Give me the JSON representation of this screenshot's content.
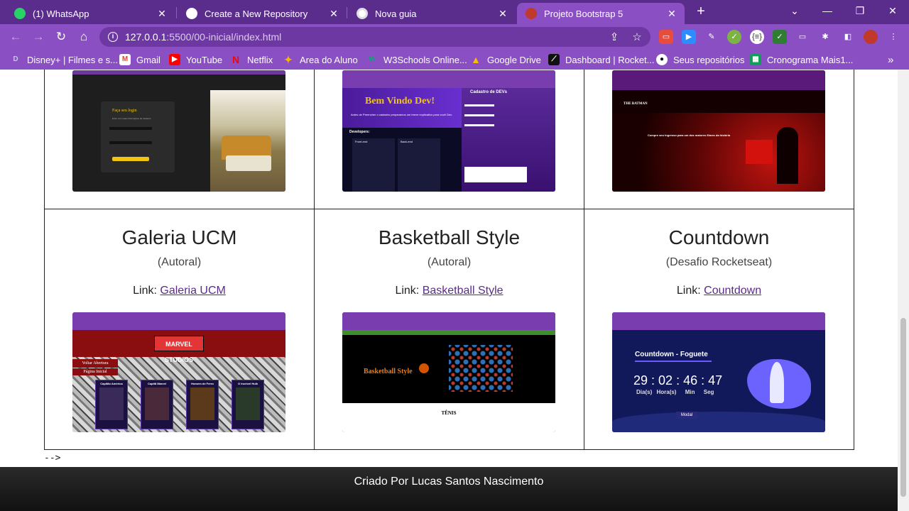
{
  "browser": {
    "tabs": [
      {
        "title": "(1) WhatsApp",
        "icon": "whatsapp-icon",
        "color": "#25d366"
      },
      {
        "title": "Create a New Repository",
        "icon": "github-icon",
        "color": "#ffffff"
      },
      {
        "title": "Nova guia",
        "icon": "chrome-icon",
        "color": "#ffffff"
      },
      {
        "title": "Projeto Bootstrap 5",
        "icon": "avatar-icon",
        "color": "#c0392b"
      }
    ],
    "address": {
      "host": "127.0.0.1",
      "path": ":5500/00-inicial/index.html"
    },
    "bookmarks": [
      {
        "label": "Disney+ | Filmes e s...",
        "icon": "disney-icon"
      },
      {
        "label": "Gmail",
        "icon": "gmail-icon"
      },
      {
        "label": "YouTube",
        "icon": "youtube-icon"
      },
      {
        "label": "Netflix",
        "icon": "netflix-icon"
      },
      {
        "label": "Area do Aluno",
        "icon": "star-icon"
      },
      {
        "label": "W3Schools Online...",
        "icon": "w3schools-icon"
      },
      {
        "label": "Google Drive",
        "icon": "drive-icon"
      },
      {
        "label": "Dashboard | Rocket...",
        "icon": "rocketseat-icon"
      },
      {
        "label": "Seus repositórios",
        "icon": "github-icon"
      },
      {
        "label": "Cronograma Mais1...",
        "icon": "sheets-icon"
      }
    ]
  },
  "top_row_previews": [
    {
      "login_title": "Faça seu login",
      "login_sub": "Entre com suas informações de cadastro"
    },
    {
      "welcome": "Bem Vindo Dev!",
      "welcome_text": "Antes de Preencher o cadastro preparamos um breve explicativo para você Dev.",
      "form_title": "Cadastro de DEVs",
      "developers": "Developers:",
      "front": "Front-end",
      "back": "Back-end"
    },
    {
      "brand": "THE BATMAN",
      "headline": "Compre seu Ingresso para um dos maiores filmes da história"
    }
  ],
  "projects": [
    {
      "title": "Galeria UCM",
      "subtitle": "(Autoral)",
      "link_prefix": "Link:",
      "link_label": "Galeria UCM"
    },
    {
      "title": "Basketball Style",
      "subtitle": "(Autoral)",
      "link_prefix": "Link:",
      "link_label": "Basketball Style"
    },
    {
      "title": "Countdown",
      "subtitle": "(Desafio Rocketseat)",
      "link_prefix": "Link:",
      "link_label": "Countdown"
    }
  ],
  "previews": {
    "ucm": {
      "banner": "MARVEL STUDIOS",
      "back": "Voltar Abertura",
      "home": "Página Inicial",
      "cards": [
        "Capitão América",
        "Capitã Marvel",
        "Homem de Ferro",
        "O Incrível Hulk"
      ]
    },
    "basket": {
      "title": "Basketball Style",
      "tab": "TÊNIS"
    },
    "countdown": {
      "title": "Countdown - Foguete",
      "days": "29",
      "hours": "02",
      "minutes": "46",
      "seconds": "47",
      "labels": [
        "Dia(s)",
        "Hora(s)",
        "Min",
        "Seg"
      ],
      "modal": "Modal"
    }
  },
  "comment_tail": "-->",
  "footer": {
    "text": "Criado Por Lucas Santos Nascimento"
  },
  "colors": {
    "chrome": "#5a2d8c",
    "toolbar": "#8b4fc4",
    "link": "#5b2b8a"
  }
}
